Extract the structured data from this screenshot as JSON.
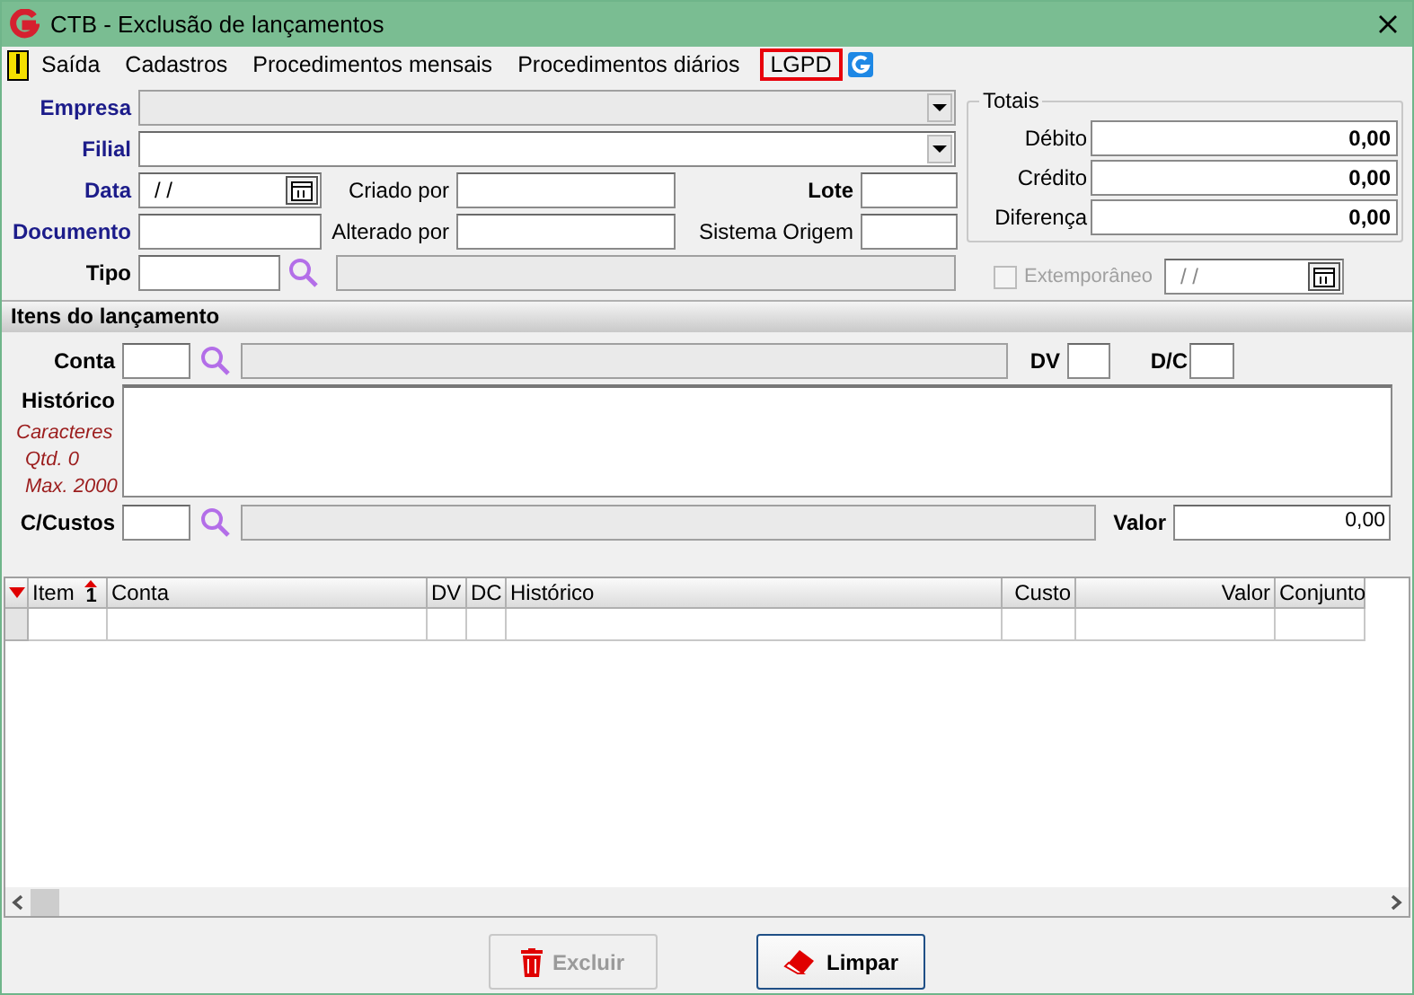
{
  "window": {
    "title": "CTB - Exclusão de lançamentos"
  },
  "menu": [
    {
      "label": "Saída",
      "highlighted": false,
      "kind": "exit"
    },
    {
      "label": "Cadastros",
      "highlighted": false,
      "kind": "plain"
    },
    {
      "label": "Procedimentos mensais",
      "highlighted": false,
      "kind": "plain"
    },
    {
      "label": "Procedimentos diários",
      "highlighted": false,
      "kind": "plain"
    },
    {
      "label": "LGPD",
      "highlighted": true,
      "kind": "plain"
    }
  ],
  "header": {
    "empresa": {
      "label": "Empresa",
      "required": true
    },
    "filial": {
      "label": "Filial",
      "required": true
    },
    "data": {
      "label": "Data",
      "required": true,
      "value": "/ /"
    },
    "criado_por": {
      "label": "Criado por"
    },
    "lote": {
      "label": "Lote"
    },
    "documento": {
      "label": "Documento",
      "required": true
    },
    "alterado_por": {
      "label": "Alterado por"
    },
    "sistema_origem": {
      "label": "Sistema Origem"
    },
    "tipo": {
      "label": "Tipo",
      "required": false
    }
  },
  "totais": {
    "title": "Totais",
    "rows": [
      {
        "label": "Débito",
        "value": "0,00"
      },
      {
        "label": "Crédito",
        "value": "0,00"
      },
      {
        "label": "Diferença",
        "value": "0,00"
      }
    ]
  },
  "extemporaneo": {
    "label": "Extemporâneo",
    "checked": false,
    "disabled": true,
    "date": "/ /"
  },
  "itens": {
    "title": "Itens do lançamento",
    "conta": {
      "label": "Conta"
    },
    "dv": {
      "label": "DV"
    },
    "dc": {
      "label": "D/C"
    },
    "historico": {
      "label": "Histórico",
      "hints": [
        "Caracteres",
        "Qtd. 0",
        "Max. 2000"
      ]
    },
    "c_custos": {
      "label": "C/Custos"
    },
    "valor": {
      "label": "Valor",
      "value": "0,00"
    }
  },
  "grid": {
    "columns": [
      {
        "label": "Item",
        "sort_order": "1"
      },
      {
        "label": "Conta"
      },
      {
        "label": "DV"
      },
      {
        "label": "DC"
      },
      {
        "label": "Histórico"
      },
      {
        "label": "Custo"
      },
      {
        "label": "Valor"
      },
      {
        "label": "Conjunto"
      }
    ]
  },
  "buttons": [
    {
      "label": "Excluir",
      "disabled": true,
      "kind": "delete"
    },
    {
      "label": "Limpar",
      "disabled": false,
      "kind": "clear"
    }
  ]
}
